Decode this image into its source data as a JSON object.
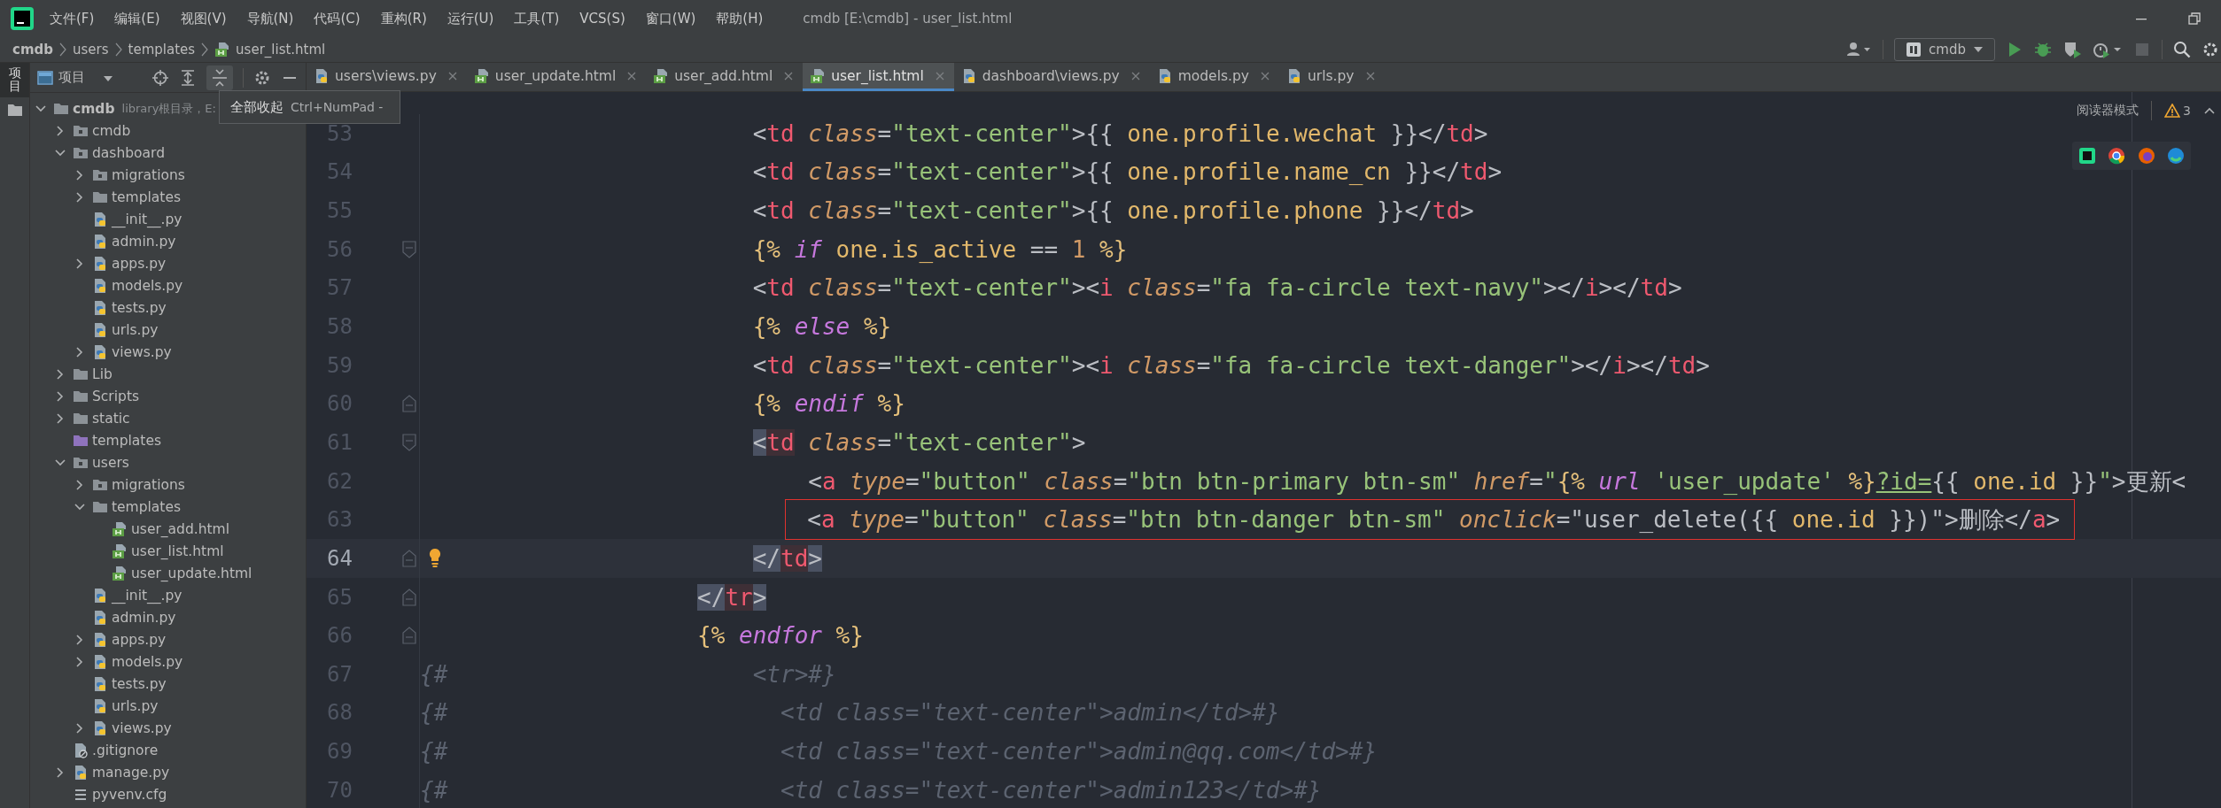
{
  "menu_bar": {
    "items": [
      "文件(F)",
      "编辑(E)",
      "视图(V)",
      "导航(N)",
      "代码(C)",
      "重构(R)",
      "运行(U)",
      "工具(T)",
      "VCS(S)",
      "窗口(W)",
      "帮助(H)"
    ],
    "title": "cmdb [E:\\cmdb] - user_list.html"
  },
  "breadcrumb": [
    {
      "label": "cmdb",
      "kind": "project"
    },
    {
      "label": "users",
      "kind": "folder"
    },
    {
      "label": "templates",
      "kind": "folder"
    },
    {
      "label": "user_list.html",
      "kind": "html"
    }
  ],
  "run_toolbar": {
    "configuration": "cmdb"
  },
  "tool_stripe": {
    "label": "项目",
    "selected": true
  },
  "project_panel": {
    "title": "项目",
    "tree": [
      {
        "label": "cmdb",
        "kind": "folder",
        "expanded": true,
        "hint": "library根目录，E:",
        "children": [
          {
            "label": "cmdb",
            "kind": "module",
            "expanded": false
          },
          {
            "label": "dashboard",
            "kind": "module",
            "expanded": true,
            "children": [
              {
                "label": "migrations",
                "kind": "module",
                "expanded": false
              },
              {
                "label": "templates",
                "kind": "folder",
                "expanded": false
              },
              {
                "label": "__init__.py",
                "kind": "python"
              },
              {
                "label": "admin.py",
                "kind": "python"
              },
              {
                "label": "apps.py",
                "kind": "python",
                "expanded": false
              },
              {
                "label": "models.py",
                "kind": "python"
              },
              {
                "label": "tests.py",
                "kind": "python"
              },
              {
                "label": "urls.py",
                "kind": "python"
              },
              {
                "label": "views.py",
                "kind": "python",
                "expanded": false
              }
            ]
          },
          {
            "label": "Lib",
            "kind": "folder",
            "expanded": false
          },
          {
            "label": "Scripts",
            "kind": "folder",
            "expanded": false
          },
          {
            "label": "static",
            "kind": "folder",
            "expanded": false
          },
          {
            "label": "templates",
            "kind": "templates"
          },
          {
            "label": "users",
            "kind": "module",
            "expanded": true,
            "children": [
              {
                "label": "migrations",
                "kind": "module",
                "expanded": false
              },
              {
                "label": "templates",
                "kind": "folder",
                "expanded": true,
                "children": [
                  {
                    "label": "user_add.html",
                    "kind": "html"
                  },
                  {
                    "label": "user_list.html",
                    "kind": "html"
                  },
                  {
                    "label": "user_update.html",
                    "kind": "html"
                  }
                ]
              },
              {
                "label": "__init__.py",
                "kind": "python"
              },
              {
                "label": "admin.py",
                "kind": "python"
              },
              {
                "label": "apps.py",
                "kind": "python",
                "expanded": false
              },
              {
                "label": "models.py",
                "kind": "python",
                "expanded": false
              },
              {
                "label": "tests.py",
                "kind": "python"
              },
              {
                "label": "urls.py",
                "kind": "python"
              },
              {
                "label": "views.py",
                "kind": "python",
                "expanded": false
              }
            ]
          },
          {
            "label": ".gitignore",
            "kind": "ignore"
          },
          {
            "label": "manage.py",
            "kind": "python",
            "expanded": false
          },
          {
            "label": "pyvenv.cfg",
            "kind": "config"
          }
        ]
      }
    ]
  },
  "tooltip": {
    "text": "全部收起",
    "shortcut": "Ctrl+NumPad -"
  },
  "tabs": [
    {
      "label": "users\\views.py",
      "kind": "python",
      "selected": false
    },
    {
      "label": "user_update.html",
      "kind": "html",
      "selected": false
    },
    {
      "label": "user_add.html",
      "kind": "html",
      "selected": false
    },
    {
      "label": "user_list.html",
      "kind": "html",
      "selected": true
    },
    {
      "label": "dashboard\\views.py",
      "kind": "python",
      "selected": false
    },
    {
      "label": "models.py",
      "kind": "python",
      "selected": false
    },
    {
      "label": "urls.py",
      "kind": "python",
      "selected": false
    }
  ],
  "editor": {
    "reader_mode": "阅读器模式",
    "warnings": "3",
    "lines": [
      {
        "number": "53",
        "segments": [
          {
            "kind": "punct",
            "text": "                        <"
          },
          {
            "kind": "tag",
            "text": "td"
          },
          {
            "kind": "attr",
            "text": " class"
          },
          {
            "kind": "punct",
            "text": "="
          },
          {
            "kind": "value",
            "text": "\"text-center\""
          },
          {
            "kind": "punct",
            "text": ">{{ "
          },
          {
            "kind": "var",
            "text": "one.profile.wechat"
          },
          {
            "kind": "punct",
            "text": " }}</"
          },
          {
            "kind": "tag",
            "text": "td"
          },
          {
            "kind": "punct",
            "text": ">"
          }
        ]
      },
      {
        "number": "54",
        "segments": [
          {
            "kind": "punct",
            "text": "                        <"
          },
          {
            "kind": "tag",
            "text": "td"
          },
          {
            "kind": "attr",
            "text": " class"
          },
          {
            "kind": "punct",
            "text": "="
          },
          {
            "kind": "value",
            "text": "\"text-center\""
          },
          {
            "kind": "punct",
            "text": ">{{ "
          },
          {
            "kind": "var",
            "text": "one.profile.name_cn"
          },
          {
            "kind": "punct",
            "text": " }}</"
          },
          {
            "kind": "tag",
            "text": "td"
          },
          {
            "kind": "punct",
            "text": ">"
          }
        ]
      },
      {
        "number": "55",
        "segments": [
          {
            "kind": "punct",
            "text": "                        <"
          },
          {
            "kind": "tag",
            "text": "td"
          },
          {
            "kind": "attr",
            "text": " class"
          },
          {
            "kind": "punct",
            "text": "="
          },
          {
            "kind": "value",
            "text": "\"text-center\""
          },
          {
            "kind": "punct",
            "text": ">{{ "
          },
          {
            "kind": "var",
            "text": "one.profile.phone"
          },
          {
            "kind": "punct",
            "text": " }}</"
          },
          {
            "kind": "tag",
            "text": "td"
          },
          {
            "kind": "punct",
            "text": ">"
          }
        ]
      },
      {
        "number": "56",
        "fold_start": true,
        "segments": [
          {
            "kind": "tmpl",
            "text": "                        {% "
          },
          {
            "kind": "keyword",
            "text": "if"
          },
          {
            "kind": "var",
            "text": " one.is_active "
          },
          {
            "kind": "punct",
            "text": "== "
          },
          {
            "kind": "number",
            "text": "1"
          },
          {
            "kind": "tmpl",
            "text": " %}"
          }
        ]
      },
      {
        "number": "57",
        "segments": [
          {
            "kind": "punct",
            "text": "                        <"
          },
          {
            "kind": "tag",
            "text": "td"
          },
          {
            "kind": "attr",
            "text": " class"
          },
          {
            "kind": "punct",
            "text": "="
          },
          {
            "kind": "value",
            "text": "\"text-center\""
          },
          {
            "kind": "punct",
            "text": "><"
          },
          {
            "kind": "tag",
            "text": "i"
          },
          {
            "kind": "attr",
            "text": " class"
          },
          {
            "kind": "punct",
            "text": "="
          },
          {
            "kind": "value",
            "text": "\"fa fa-circle text-navy\""
          },
          {
            "kind": "punct",
            "text": "></"
          },
          {
            "kind": "tag",
            "text": "i"
          },
          {
            "kind": "punct",
            "text": "></"
          },
          {
            "kind": "tag",
            "text": "td"
          },
          {
            "kind": "punct",
            "text": ">"
          }
        ]
      },
      {
        "number": "58",
        "segments": [
          {
            "kind": "tmpl",
            "text": "                        {% "
          },
          {
            "kind": "keyword",
            "text": "else"
          },
          {
            "kind": "tmpl",
            "text": " %}"
          }
        ]
      },
      {
        "number": "59",
        "segments": [
          {
            "kind": "punct",
            "text": "                        <"
          },
          {
            "kind": "tag",
            "text": "td"
          },
          {
            "kind": "attr",
            "text": " class"
          },
          {
            "kind": "punct",
            "text": "="
          },
          {
            "kind": "value",
            "text": "\"text-center\""
          },
          {
            "kind": "punct",
            "text": "><"
          },
          {
            "kind": "tag",
            "text": "i"
          },
          {
            "kind": "attr",
            "text": " class"
          },
          {
            "kind": "punct",
            "text": "="
          },
          {
            "kind": "value",
            "text": "\"fa fa-circle text-danger\""
          },
          {
            "kind": "punct",
            "text": "></"
          },
          {
            "kind": "tag",
            "text": "i"
          },
          {
            "kind": "punct",
            "text": "></"
          },
          {
            "kind": "tag",
            "text": "td"
          },
          {
            "kind": "punct",
            "text": ">"
          }
        ]
      },
      {
        "number": "60",
        "fold_end": true,
        "segments": [
          {
            "kind": "tmpl",
            "text": "                        {% "
          },
          {
            "kind": "keyword",
            "text": "endif"
          },
          {
            "kind": "tmpl",
            "text": " %}"
          }
        ]
      },
      {
        "number": "61",
        "fold_start": true,
        "segments": [
          {
            "kind": "punct",
            "text": "                        <",
            "highlighted": true
          },
          {
            "kind": "tag",
            "text": "td",
            "highlighted": true
          },
          {
            "kind": "attr",
            "text": " class"
          },
          {
            "kind": "punct",
            "text": "="
          },
          {
            "kind": "value",
            "text": "\"text-center\""
          },
          {
            "kind": "punct",
            "text": ">"
          }
        ]
      },
      {
        "number": "62",
        "segments": [
          {
            "kind": "punct",
            "text": "                            <"
          },
          {
            "kind": "tag",
            "text": "a"
          },
          {
            "kind": "attr",
            "text": " type"
          },
          {
            "kind": "punct",
            "text": "="
          },
          {
            "kind": "value",
            "text": "\"button\""
          },
          {
            "kind": "attr",
            "text": " class"
          },
          {
            "kind": "punct",
            "text": "="
          },
          {
            "kind": "value",
            "text": "\"btn btn-primary btn-sm\""
          },
          {
            "kind": "attr",
            "text": " href"
          },
          {
            "kind": "punct",
            "text": "="
          },
          {
            "kind": "value",
            "text": "\""
          },
          {
            "kind": "tmpl",
            "text": "{% "
          },
          {
            "kind": "keyword",
            "text": "url "
          },
          {
            "kind": "value",
            "text": "'user_update'"
          },
          {
            "kind": "tmpl",
            "text": " %}"
          },
          {
            "kind": "value",
            "text": "?id=",
            "underlined": true
          },
          {
            "kind": "punct",
            "text": "{{ "
          },
          {
            "kind": "var",
            "text": "one.id"
          },
          {
            "kind": "punct",
            "text": " }}"
          },
          {
            "kind": "value",
            "text": "\""
          },
          {
            "kind": "punct",
            "text": ">"
          },
          {
            "kind": "text",
            "text": "更新"
          },
          {
            "kind": "punct",
            "text": "<"
          }
        ]
      },
      {
        "number": "63",
        "boxed": true,
        "segments": [
          {
            "kind": "punct",
            "text": "                            <"
          },
          {
            "kind": "tag",
            "text": "a"
          },
          {
            "kind": "attr",
            "text": " type"
          },
          {
            "kind": "punct",
            "text": "="
          },
          {
            "kind": "value",
            "text": "\"button\""
          },
          {
            "kind": "attr",
            "text": " class"
          },
          {
            "kind": "punct",
            "text": "="
          },
          {
            "kind": "value",
            "text": "\"btn btn-danger btn-sm\""
          },
          {
            "kind": "attr",
            "text": " onclick"
          },
          {
            "kind": "punct",
            "text": "=\"user_delete({{ "
          },
          {
            "kind": "var",
            "text": "one.id"
          },
          {
            "kind": "punct",
            "text": " }})\">"
          },
          {
            "kind": "text",
            "text": "删除"
          },
          {
            "kind": "punct",
            "text": "</"
          },
          {
            "kind": "tag",
            "text": "a"
          },
          {
            "kind": "punct",
            "text": ">"
          }
        ]
      },
      {
        "number": "64",
        "current": true,
        "bulb": true,
        "fold_end": true,
        "segments": [
          {
            "kind": "punct",
            "text": "                        </",
            "highlighted": true
          },
          {
            "kind": "tag",
            "text": "td",
            "highlighted": true
          },
          {
            "kind": "punct",
            "text": ">",
            "highlighted": true
          }
        ]
      },
      {
        "number": "65",
        "fold_end": true,
        "segments": [
          {
            "kind": "punct",
            "text": "                    </",
            "highlighted": true
          },
          {
            "kind": "tag",
            "text": "tr",
            "highlighted": true
          },
          {
            "kind": "punct",
            "text": ">",
            "highlighted": true
          }
        ]
      },
      {
        "number": "66",
        "fold_end": true,
        "segments": [
          {
            "kind": "tmpl",
            "text": "                    {% "
          },
          {
            "kind": "keyword",
            "text": "endfor"
          },
          {
            "kind": "tmpl",
            "text": " %}"
          }
        ]
      },
      {
        "number": "67",
        "segments": [
          {
            "kind": "comment",
            "text": "{#                      <tr>#}"
          }
        ]
      },
      {
        "number": "68",
        "segments": [
          {
            "kind": "comment",
            "text": "{#                        <td class=\"text-center\">admin</td>#}"
          }
        ]
      },
      {
        "number": "69",
        "segments": [
          {
            "kind": "comment",
            "text": "{#                        <td class=\"text-center\">admin@qq.com</td>#}"
          }
        ]
      },
      {
        "number": "70",
        "segments": [
          {
            "kind": "comment",
            "text": "{#                        <td class=\"text-center\">admin123</td>#}"
          }
        ]
      }
    ]
  }
}
